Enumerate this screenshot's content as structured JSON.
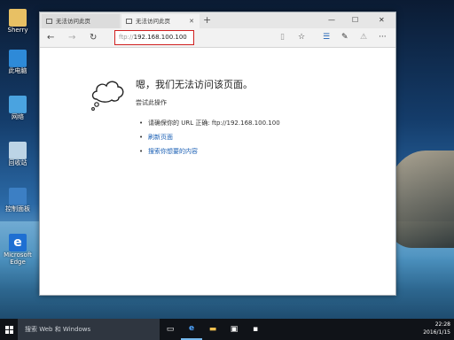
{
  "desktop": {
    "icons": [
      {
        "label": "Sherry"
      },
      {
        "label": "此电脑"
      },
      {
        "label": "网络"
      },
      {
        "label": "回收站"
      },
      {
        "label": "控制面板"
      },
      {
        "label": "Microsoft Edge"
      }
    ]
  },
  "browser": {
    "tabs": [
      {
        "label": "无法访问此页"
      },
      {
        "label": "无法访问此页"
      }
    ],
    "new_tab": "+",
    "address": {
      "protocol": "ftp://",
      "host": "192.168.100.100"
    },
    "window_controls": {
      "minimize": "—",
      "maximize": "☐",
      "close": "✕"
    },
    "nav": {
      "back": "←",
      "forward": "→",
      "refresh": "↻"
    },
    "tools": {
      "reading": "▯",
      "favorite": "☆",
      "hub": "☰",
      "note": "✎",
      "share": "⚠",
      "more": "···"
    }
  },
  "error_page": {
    "heading": "嗯，我们无法访问该页面。",
    "subtitle": "尝试此操作",
    "bullets": [
      {
        "text": "请确保你的 URL 正确: ftp://192.168.100.100",
        "link": false
      },
      {
        "text": "刷新页面",
        "link": true
      },
      {
        "text": "搜索你想要的内容",
        "link": true
      }
    ]
  },
  "taskbar": {
    "search_placeholder": "搜索 Web 和 Windows",
    "clock_time": "22:28",
    "clock_date": "2016/1/15"
  }
}
